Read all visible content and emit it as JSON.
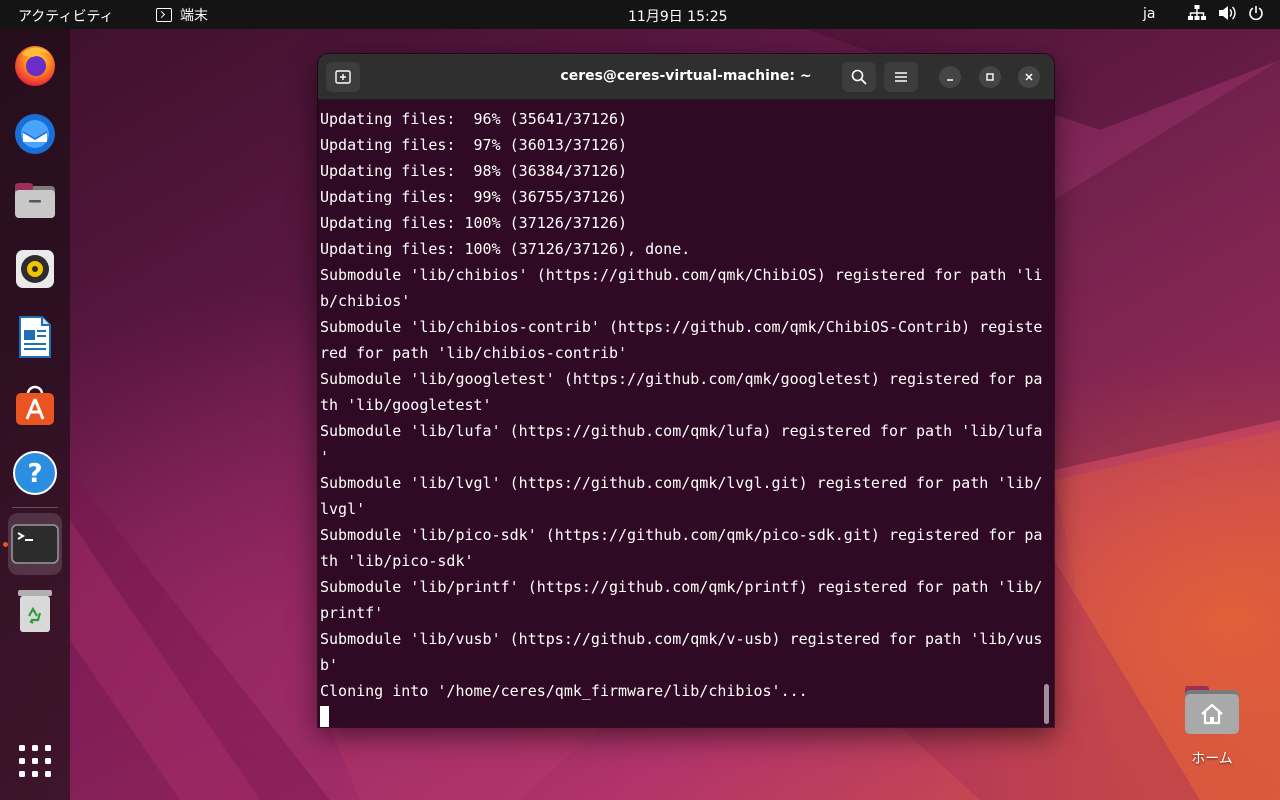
{
  "topbar": {
    "activities_label": "アクティビティ",
    "app_menu_label": "端末",
    "clock": "11月9日  15:25",
    "input_language": "ja"
  },
  "dock": {
    "items": [
      {
        "name": "firefox",
        "icon": "firefox-icon"
      },
      {
        "name": "thunderbird",
        "icon": "thunderbird-icon"
      },
      {
        "name": "files",
        "icon": "files-icon"
      },
      {
        "name": "rhythmbox",
        "icon": "rhythmbox-icon"
      },
      {
        "name": "libreoffice-writer",
        "icon": "writer-icon"
      },
      {
        "name": "ubuntu-software",
        "icon": "software-icon"
      },
      {
        "name": "help",
        "icon": "help-icon"
      },
      {
        "name": "terminal",
        "icon": "terminal-icon",
        "running": true
      },
      {
        "name": "trash",
        "icon": "trash-icon"
      }
    ],
    "show_apps_icon": "app-grid-icon"
  },
  "window": {
    "title": "ceres@ceres-virtual-machine: ~",
    "lines": [
      "Updating files:  96% (35641/37126)",
      "Updating files:  97% (36013/37126)",
      "Updating files:  98% (36384/37126)",
      "Updating files:  99% (36755/37126)",
      "Updating files: 100% (37126/37126)",
      "Updating files: 100% (37126/37126), done.",
      "Submodule 'lib/chibios' (https://github.com/qmk/ChibiOS) registered for path 'li",
      "b/chibios'",
      "Submodule 'lib/chibios-contrib' (https://github.com/qmk/ChibiOS-Contrib) registe",
      "red for path 'lib/chibios-contrib'",
      "Submodule 'lib/googletest' (https://github.com/qmk/googletest) registered for pa",
      "th 'lib/googletest'",
      "Submodule 'lib/lufa' (https://github.com/qmk/lufa) registered for path 'lib/lufa",
      "'",
      "Submodule 'lib/lvgl' (https://github.com/qmk/lvgl.git) registered for path 'lib/",
      "lvgl'",
      "Submodule 'lib/pico-sdk' (https://github.com/qmk/pico-sdk.git) registered for pa",
      "th 'lib/pico-sdk'",
      "Submodule 'lib/printf' (https://github.com/qmk/printf) registered for path 'lib/",
      "printf'",
      "Submodule 'lib/vusb' (https://github.com/qmk/v-usb) registered for path 'lib/vus",
      "b'",
      "Cloning into '/home/ceres/qmk_firmware/lib/chibios'..."
    ]
  },
  "desktop": {
    "home_label": "ホーム"
  },
  "colors": {
    "terminal_bg": "#300a24",
    "headerbar_bg": "#2f2f2f",
    "accent": "#e95420"
  }
}
